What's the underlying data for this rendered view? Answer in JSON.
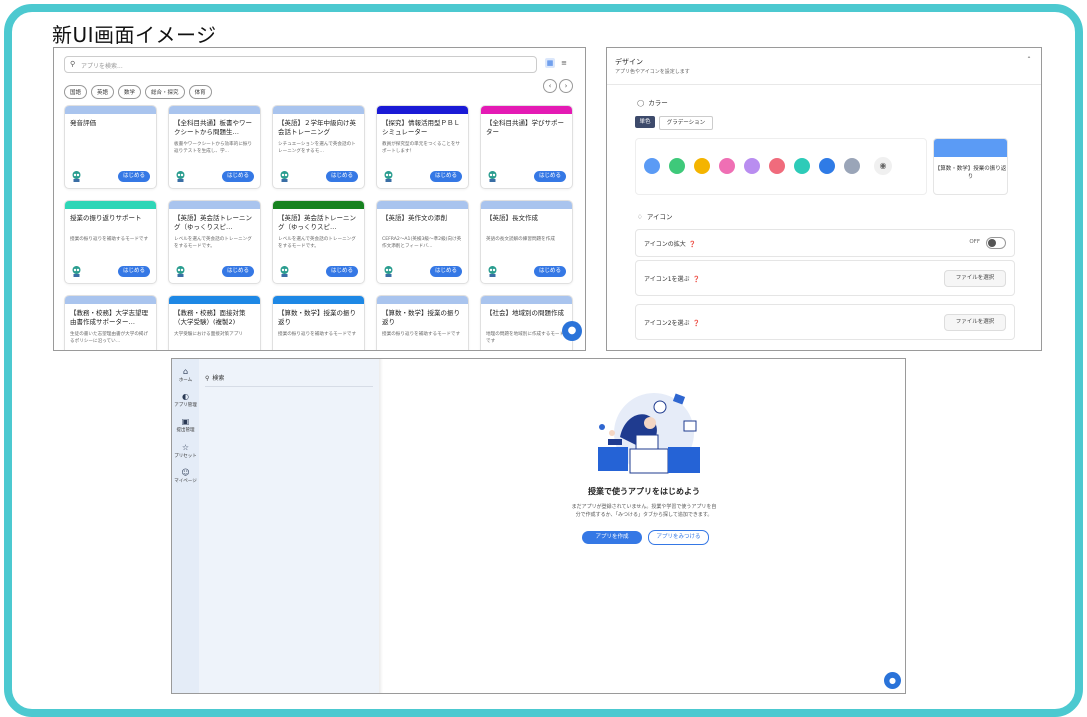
{
  "title": "新UI画面イメージ",
  "colors": {
    "frame": "#4cc9d0",
    "primary": "#3578e5"
  },
  "screen1": {
    "search_placeholder": "アプリを検索...",
    "grid_icon": "grid-view-icon",
    "list_icon": "list-view-icon",
    "chips": [
      "国語",
      "英語",
      "数学",
      "総合・探究",
      "体育"
    ],
    "prev": "‹",
    "next": "›",
    "start_label": "はじめる",
    "cards": [
      {
        "title": "発音評価",
        "desc": "",
        "color": "#a9c4ee"
      },
      {
        "title": "【全科目共通】板書やワークシートから問題生…",
        "desc": "板書やワークシートから効率的に振り返りテストを生成し、学…",
        "color": "#a9c4ee"
      },
      {
        "title": "【英語】２学年中級向け英会話トレーニング",
        "desc": "シチュエーションを選んで英会話のトレーニングをするモ…",
        "color": "#a9c4ee"
      },
      {
        "title": "【探究】情報活用型ＰＢＬシミュレーター",
        "desc": "教員が探究型の単元をつくることをサポートします！",
        "color": "#1a1ad6"
      },
      {
        "title": "【全科目共通】学びサポーター",
        "desc": "",
        "color": "#e41ab4"
      },
      {
        "title": "授業の振り返りサポート",
        "desc": "授業の振り返りを補助するモードです",
        "color": "#2fd6b7"
      },
      {
        "title": "【英語】英会話トレーニング（ゆっくりスピ…",
        "desc": "レベルを選んで英会話のトレーニングをするモードです。",
        "color": "#a9c4ee"
      },
      {
        "title": "【英語】英会話トレーニング（ゆっくりスピ…",
        "desc": "レベルを選んで英会話のトレーニングをするモードです。",
        "color": "#16821f"
      },
      {
        "title": "【英語】英作文の添削",
        "desc": "CEFRA2〜A1(英検3級〜準2級)向け英作文添削とフィードバ…",
        "color": "#a9c4ee"
      },
      {
        "title": "【英語】長文作成",
        "desc": "英語の長文読解の練習問題を作成",
        "color": "#a9c4ee"
      },
      {
        "title": "【教務・校務】大学志望理由書作成サポーター…",
        "desc": "生徒の書いた志望理由書が大学の掲げるポリシーに沿ってい…",
        "color": "#a9c4ee"
      },
      {
        "title": "【教務・校務】面接対策（大学受験）(複製2)",
        "desc": "大学受験における面接対策アプリ",
        "color": "#1e88e5"
      },
      {
        "title": "【算数・数学】授業の振り返り",
        "desc": "授業の振り返りを補助するモードです",
        "color": "#1e88e5"
      },
      {
        "title": "【算数・数学】授業の振り返り",
        "desc": "授業の振り返りを補助するモードです",
        "color": "#a9c4ee"
      },
      {
        "title": "【社会】地域別の問題作成",
        "desc": "地理の問題を地域別に作成するモードです",
        "color": "#a9c4ee"
      }
    ]
  },
  "screen2": {
    "title": "デザイン",
    "subtitle": "アプリ色やアイコンを設定します",
    "color_section": "カラー",
    "tab_single": "単色",
    "tab_gradient": "グラデーション",
    "swatches": [
      "#5b9bf5",
      "#3ec97a",
      "#f4b400",
      "#ef6fb4",
      "#b98df0",
      "#f06b7c",
      "#2dcbb8",
      "#2f7be6",
      "#9aa5b8"
    ],
    "preview_label": "【算数・数学】授業の振り返り",
    "icon_section": "アイコン",
    "zoom_label": "アイコンの拡大",
    "off_label": "OFF",
    "icon1_label": "アイコン1を選ぶ",
    "icon2_label": "アイコン2を選ぶ",
    "file_button": "ファイルを選択"
  },
  "screen3": {
    "nav": [
      {
        "icon": "home-icon",
        "label": "ホーム"
      },
      {
        "icon": "app-manage-icon",
        "label": "アプリ管理"
      },
      {
        "icon": "submission-icon",
        "label": "提出管理"
      },
      {
        "icon": "preset-icon",
        "label": "プリセット"
      },
      {
        "icon": "mypage-icon",
        "label": "マイページ"
      }
    ],
    "search_label": "検索",
    "empty_title": "授業で使うアプリをはじめよう",
    "empty_desc_1": "まだアプリが登録されていません。授業や学習で使うアプリを自",
    "empty_desc_2": "分で作成するか、「みつける」タブから探して追加できます。",
    "create_button": "アプリを作成",
    "find_button": "アプリをみつける"
  }
}
